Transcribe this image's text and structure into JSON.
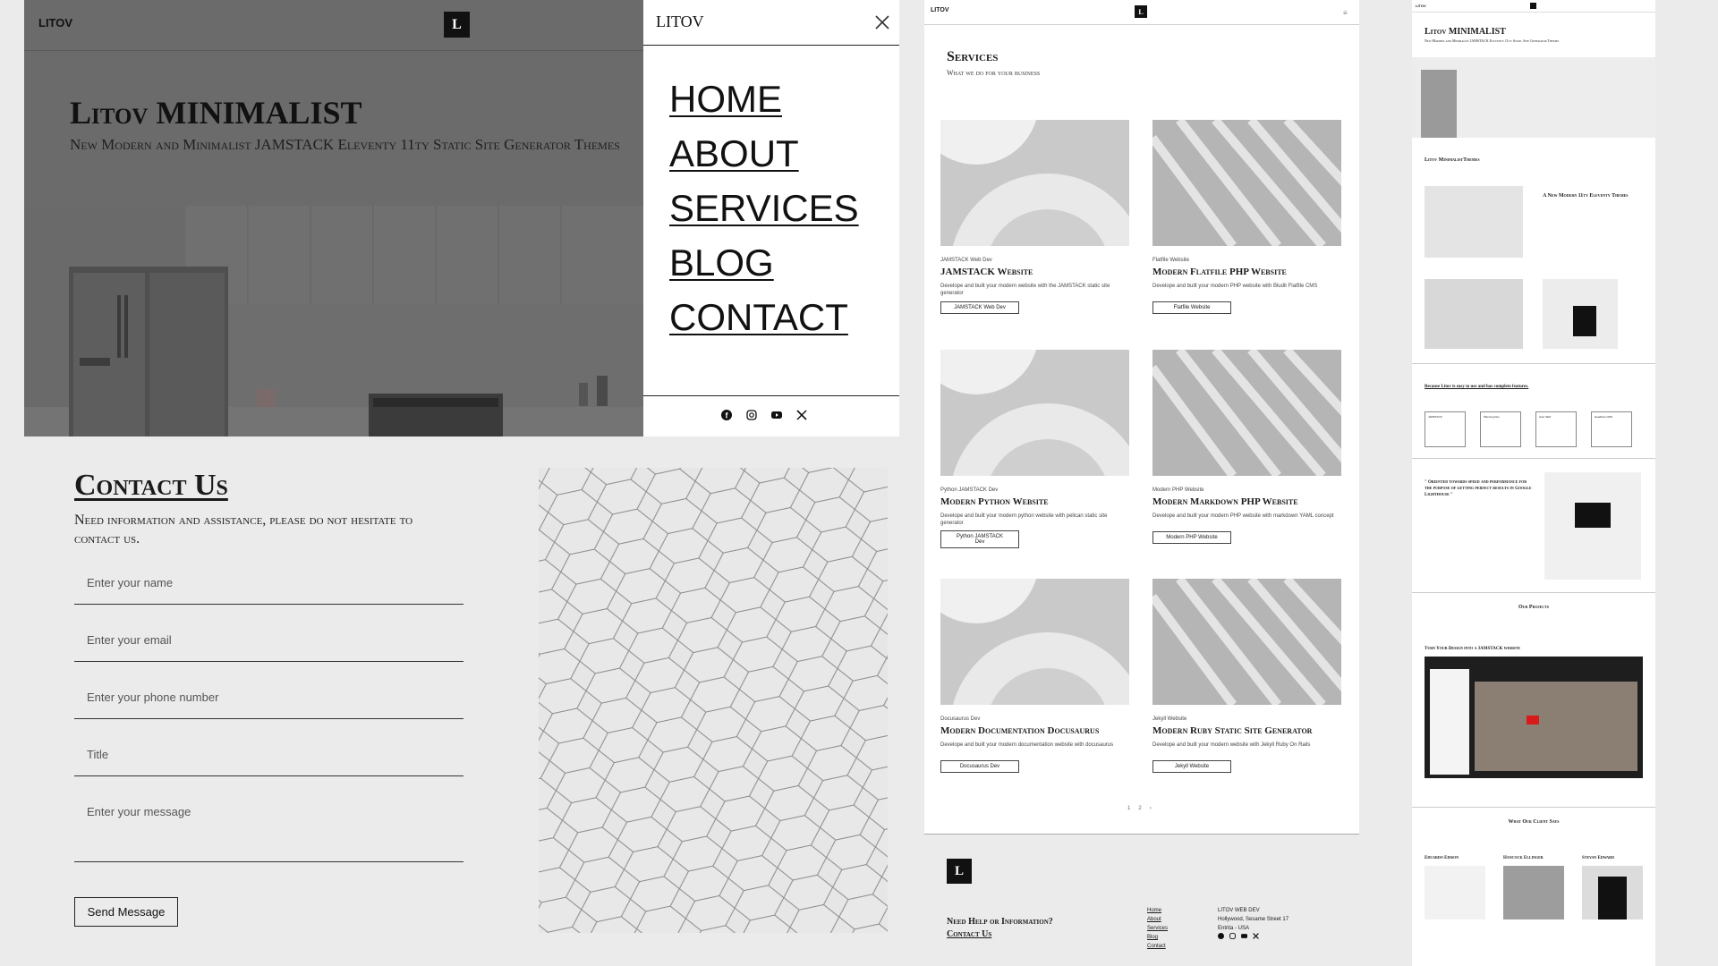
{
  "hero": {
    "brand": "LITOV",
    "logo_letter": "L",
    "title": "Litov MINIMALIST",
    "subtitle": "New Modern and Minimalist JAMSTACK Eleventy 11ty Static Site Generator Themes"
  },
  "menu": {
    "brand": "LITOV",
    "items": [
      "HOME",
      "ABOUT",
      "SERVICES",
      "BLOG",
      "CONTACT"
    ],
    "socials": [
      "facebook-icon",
      "instagram-icon",
      "youtube-icon",
      "x-icon"
    ]
  },
  "services": {
    "brand": "LITOV",
    "logo_letter": "L",
    "heading": "Services",
    "subheading": "What we do for your business",
    "cards": [
      {
        "tag": "JAMSTACK Web Dev",
        "title": "JAMSTACK Website",
        "desc": "Develope and built your modern website with the JAMSTACK static site generator",
        "button": "JAMSTACK Web Dev"
      },
      {
        "tag": "Flatfile Website",
        "title": "Modern Flatfile PHP Website",
        "desc": "Develope and built your modern PHP website with Bludit Flatfile CMS",
        "button": "Flatfile Website"
      },
      {
        "tag": "Python JAMSTACK Dev",
        "title": "Modern Python Website",
        "desc": "Develope and built your modern python website with pelican static site generator",
        "button": "Python JAMSTACK Dev"
      },
      {
        "tag": "Modern PHP Website",
        "title": "Modern Markdown PHP Website",
        "desc": "Develope and built your modern PHP website with markdown YAML concept",
        "button": "Modern PHP Website"
      },
      {
        "tag": "Docusaurus Dev",
        "title": "Modern Documentation Docusaurus",
        "desc": "Develope and built your modern documentation website with docusaurus",
        "button": "Docusaurus Dev"
      },
      {
        "tag": "Jekyll Website",
        "title": "Modern Ruby Static Site Generator",
        "desc": "Develope and built your modern website with Jekyll Ruby On Rails",
        "button": "Jekyll Website"
      }
    ],
    "pager": [
      "1",
      "2",
      "›"
    ]
  },
  "footer": {
    "logo_letter": "L",
    "help": "Need Help or Information?",
    "contact_link": "Contact Us",
    "links": [
      "Home",
      "About",
      "Services",
      "Blog",
      "Contact"
    ],
    "company": "LITOV WEB DEV",
    "address1": "Hollywood, Sesame Street 17",
    "address2": "Entrita - USA"
  },
  "contact": {
    "heading": "Contact Us",
    "lead": "Need information and assistance, please do not hesitate to contact us.",
    "placeholders": {
      "name": "Enter your name",
      "email": "Enter your email",
      "phone": "Enter your phone number",
      "title": "Title",
      "message": "Enter your message"
    },
    "send": "Send Message"
  },
  "preview": {
    "title": "Litov MINIMALIST",
    "subtitle": "New Modern and Minimalist JAMSTACK Eleventy 11ty Static Site Generator Themes",
    "section_tag": "Litov MinimalistThemes",
    "about_title": "A New Modern 11ty Eleventy Themes",
    "why_heading": "Because Litov is easy to use and has complete features.",
    "feature_cards": [
      "JAMSTACK",
      "Planning Dev",
      "Auto SEO",
      "Headless CMS"
    ],
    "quote": "\" Oriented towards speed and performance for the purpose of getting perfect results in Google Lighthouse \"",
    "projects_heading": "Our Projects",
    "project_title": "Turn Your Design into a JAMSTACK website",
    "clients_heading": "What Our Client Says",
    "clients": [
      "Eduardo Edison",
      "Hancock Ellinger",
      "Stevan Edward"
    ]
  }
}
